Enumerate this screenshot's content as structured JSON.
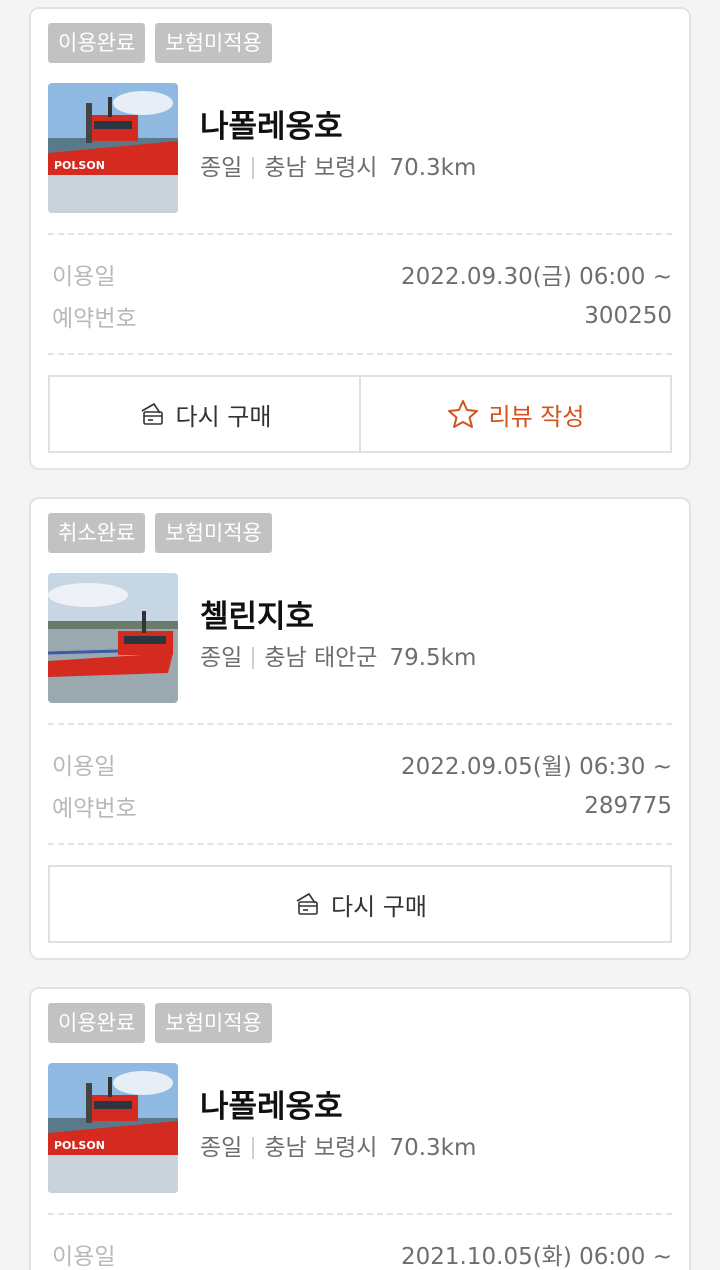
{
  "colors": {
    "accent": "#d4521e",
    "badge": "#c2c2c2"
  },
  "cards": [
    {
      "badges": [
        "이용완료",
        "보험미적용"
      ],
      "ship_name": "나폴레옹호",
      "trip_type": "종일",
      "location": "충남 보령시",
      "distance": "70.3km",
      "date_label": "이용일",
      "date_value": "2022.09.30(금) 06:00 ~",
      "reservation_label": "예약번호",
      "reservation_value": "300250",
      "rebuy_label": "다시 구매",
      "review_label": "리뷰 작성"
    },
    {
      "badges": [
        "취소완료",
        "보험미적용"
      ],
      "ship_name": "첼린지호",
      "trip_type": "종일",
      "location": "충남 태안군",
      "distance": "79.5km",
      "date_label": "이용일",
      "date_value": "2022.09.05(월) 06:30 ~",
      "reservation_label": "예약번호",
      "reservation_value": "289775",
      "rebuy_label": "다시 구매"
    },
    {
      "badges": [
        "이용완료",
        "보험미적용"
      ],
      "ship_name": "나폴레옹호",
      "trip_type": "종일",
      "location": "충남 보령시",
      "distance": "70.3km",
      "date_label": "이용일",
      "date_value": "2021.10.05(화) 06:00 ~"
    }
  ]
}
